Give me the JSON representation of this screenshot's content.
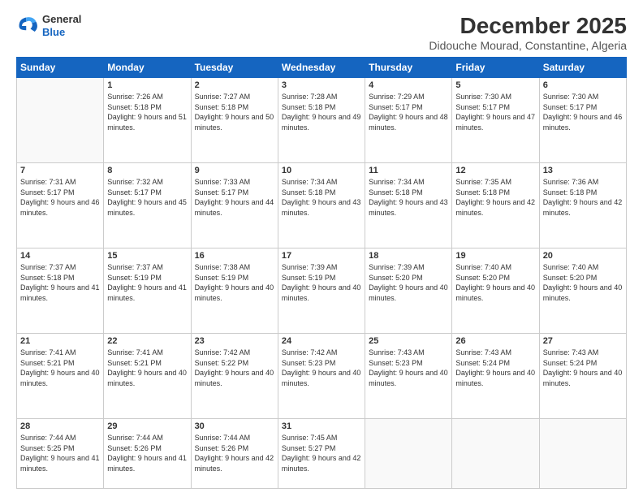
{
  "header": {
    "logo": {
      "general": "General",
      "blue": "Blue"
    },
    "title": "December 2025",
    "subtitle": "Didouche Mourad, Constantine, Algeria"
  },
  "weekdays": [
    "Sunday",
    "Monday",
    "Tuesday",
    "Wednesday",
    "Thursday",
    "Friday",
    "Saturday"
  ],
  "weeks": [
    [
      {
        "day": "",
        "sunrise": "",
        "sunset": "",
        "daylight": ""
      },
      {
        "day": "1",
        "sunrise": "Sunrise: 7:26 AM",
        "sunset": "Sunset: 5:18 PM",
        "daylight": "Daylight: 9 hours and 51 minutes."
      },
      {
        "day": "2",
        "sunrise": "Sunrise: 7:27 AM",
        "sunset": "Sunset: 5:18 PM",
        "daylight": "Daylight: 9 hours and 50 minutes."
      },
      {
        "day": "3",
        "sunrise": "Sunrise: 7:28 AM",
        "sunset": "Sunset: 5:18 PM",
        "daylight": "Daylight: 9 hours and 49 minutes."
      },
      {
        "day": "4",
        "sunrise": "Sunrise: 7:29 AM",
        "sunset": "Sunset: 5:17 PM",
        "daylight": "Daylight: 9 hours and 48 minutes."
      },
      {
        "day": "5",
        "sunrise": "Sunrise: 7:30 AM",
        "sunset": "Sunset: 5:17 PM",
        "daylight": "Daylight: 9 hours and 47 minutes."
      },
      {
        "day": "6",
        "sunrise": "Sunrise: 7:30 AM",
        "sunset": "Sunset: 5:17 PM",
        "daylight": "Daylight: 9 hours and 46 minutes."
      }
    ],
    [
      {
        "day": "7",
        "sunrise": "Sunrise: 7:31 AM",
        "sunset": "Sunset: 5:17 PM",
        "daylight": "Daylight: 9 hours and 46 minutes."
      },
      {
        "day": "8",
        "sunrise": "Sunrise: 7:32 AM",
        "sunset": "Sunset: 5:17 PM",
        "daylight": "Daylight: 9 hours and 45 minutes."
      },
      {
        "day": "9",
        "sunrise": "Sunrise: 7:33 AM",
        "sunset": "Sunset: 5:17 PM",
        "daylight": "Daylight: 9 hours and 44 minutes."
      },
      {
        "day": "10",
        "sunrise": "Sunrise: 7:34 AM",
        "sunset": "Sunset: 5:18 PM",
        "daylight": "Daylight: 9 hours and 43 minutes."
      },
      {
        "day": "11",
        "sunrise": "Sunrise: 7:34 AM",
        "sunset": "Sunset: 5:18 PM",
        "daylight": "Daylight: 9 hours and 43 minutes."
      },
      {
        "day": "12",
        "sunrise": "Sunrise: 7:35 AM",
        "sunset": "Sunset: 5:18 PM",
        "daylight": "Daylight: 9 hours and 42 minutes."
      },
      {
        "day": "13",
        "sunrise": "Sunrise: 7:36 AM",
        "sunset": "Sunset: 5:18 PM",
        "daylight": "Daylight: 9 hours and 42 minutes."
      }
    ],
    [
      {
        "day": "14",
        "sunrise": "Sunrise: 7:37 AM",
        "sunset": "Sunset: 5:18 PM",
        "daylight": "Daylight: 9 hours and 41 minutes."
      },
      {
        "day": "15",
        "sunrise": "Sunrise: 7:37 AM",
        "sunset": "Sunset: 5:19 PM",
        "daylight": "Daylight: 9 hours and 41 minutes."
      },
      {
        "day": "16",
        "sunrise": "Sunrise: 7:38 AM",
        "sunset": "Sunset: 5:19 PM",
        "daylight": "Daylight: 9 hours and 40 minutes."
      },
      {
        "day": "17",
        "sunrise": "Sunrise: 7:39 AM",
        "sunset": "Sunset: 5:19 PM",
        "daylight": "Daylight: 9 hours and 40 minutes."
      },
      {
        "day": "18",
        "sunrise": "Sunrise: 7:39 AM",
        "sunset": "Sunset: 5:20 PM",
        "daylight": "Daylight: 9 hours and 40 minutes."
      },
      {
        "day": "19",
        "sunrise": "Sunrise: 7:40 AM",
        "sunset": "Sunset: 5:20 PM",
        "daylight": "Daylight: 9 hours and 40 minutes."
      },
      {
        "day": "20",
        "sunrise": "Sunrise: 7:40 AM",
        "sunset": "Sunset: 5:20 PM",
        "daylight": "Daylight: 9 hours and 40 minutes."
      }
    ],
    [
      {
        "day": "21",
        "sunrise": "Sunrise: 7:41 AM",
        "sunset": "Sunset: 5:21 PM",
        "daylight": "Daylight: 9 hours and 40 minutes."
      },
      {
        "day": "22",
        "sunrise": "Sunrise: 7:41 AM",
        "sunset": "Sunset: 5:21 PM",
        "daylight": "Daylight: 9 hours and 40 minutes."
      },
      {
        "day": "23",
        "sunrise": "Sunrise: 7:42 AM",
        "sunset": "Sunset: 5:22 PM",
        "daylight": "Daylight: 9 hours and 40 minutes."
      },
      {
        "day": "24",
        "sunrise": "Sunrise: 7:42 AM",
        "sunset": "Sunset: 5:23 PM",
        "daylight": "Daylight: 9 hours and 40 minutes."
      },
      {
        "day": "25",
        "sunrise": "Sunrise: 7:43 AM",
        "sunset": "Sunset: 5:23 PM",
        "daylight": "Daylight: 9 hours and 40 minutes."
      },
      {
        "day": "26",
        "sunrise": "Sunrise: 7:43 AM",
        "sunset": "Sunset: 5:24 PM",
        "daylight": "Daylight: 9 hours and 40 minutes."
      },
      {
        "day": "27",
        "sunrise": "Sunrise: 7:43 AM",
        "sunset": "Sunset: 5:24 PM",
        "daylight": "Daylight: 9 hours and 40 minutes."
      }
    ],
    [
      {
        "day": "28",
        "sunrise": "Sunrise: 7:44 AM",
        "sunset": "Sunset: 5:25 PM",
        "daylight": "Daylight: 9 hours and 41 minutes."
      },
      {
        "day": "29",
        "sunrise": "Sunrise: 7:44 AM",
        "sunset": "Sunset: 5:26 PM",
        "daylight": "Daylight: 9 hours and 41 minutes."
      },
      {
        "day": "30",
        "sunrise": "Sunrise: 7:44 AM",
        "sunset": "Sunset: 5:26 PM",
        "daylight": "Daylight: 9 hours and 42 minutes."
      },
      {
        "day": "31",
        "sunrise": "Sunrise: 7:45 AM",
        "sunset": "Sunset: 5:27 PM",
        "daylight": "Daylight: 9 hours and 42 minutes."
      },
      {
        "day": "",
        "sunrise": "",
        "sunset": "",
        "daylight": ""
      },
      {
        "day": "",
        "sunrise": "",
        "sunset": "",
        "daylight": ""
      },
      {
        "day": "",
        "sunrise": "",
        "sunset": "",
        "daylight": ""
      }
    ]
  ]
}
